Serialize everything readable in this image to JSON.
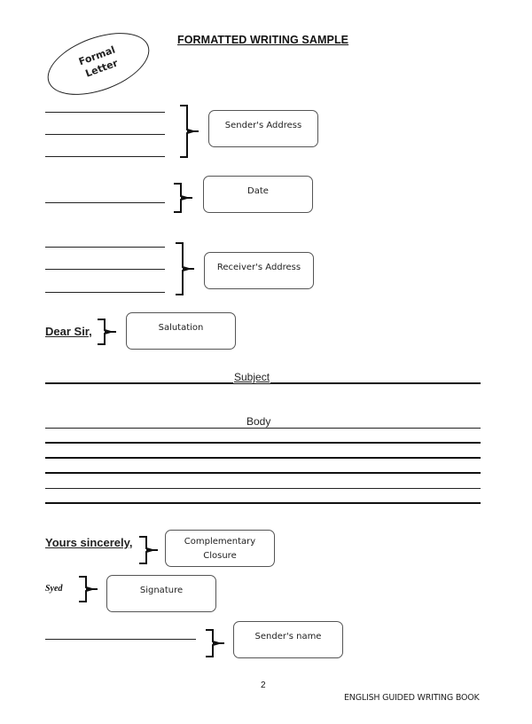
{
  "header": {
    "title": "FORMATTED WRITING SAMPLE",
    "badge_line1": "Formal",
    "badge_line2": "Letter"
  },
  "sections": {
    "senders_address": {
      "label": "Sender's Address",
      "lines": 3
    },
    "date": {
      "label": "Date",
      "lines": 1
    },
    "receivers_address": {
      "label": "Receiver's Address",
      "lines": 3
    },
    "salutation": {
      "text": "Dear Sir,",
      "label": "Salutation"
    },
    "subject": {
      "label": "Subject"
    },
    "body": {
      "label": "Body",
      "lines": 6
    },
    "closure": {
      "text": "Yours sincerely,",
      "label_line1": "Complementary",
      "label_line2": "Closure"
    },
    "signature": {
      "text": "Syed",
      "label": "Signature"
    },
    "senders_name": {
      "label": "Sender's name"
    }
  },
  "footer": {
    "page_number": "2",
    "book_title": "ENGLISH GUIDED WRITING BOOK"
  }
}
